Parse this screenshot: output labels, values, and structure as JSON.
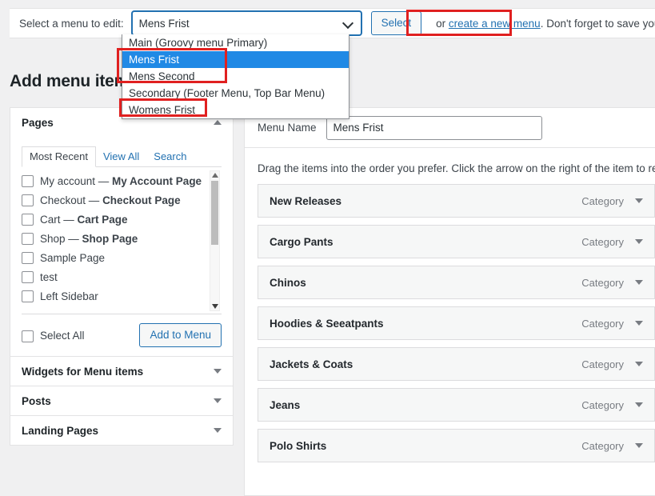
{
  "topbar": {
    "label": "Select a menu to edit:",
    "selected_menu": "Mens Frist",
    "select_button": "Select",
    "or_text": "or ",
    "create_link": "create a new menu",
    "tail_text": ". Don't forget to save your chang"
  },
  "dropdown": {
    "options": [
      {
        "label": "Main (Groovy menu Primary)",
        "selected": false
      },
      {
        "label": "Mens Frist",
        "selected": true
      },
      {
        "label": "Mens Second",
        "selected": false
      },
      {
        "label": "Secondary (Footer Menu, Top Bar Menu)",
        "selected": false
      },
      {
        "label": "Womens Frist",
        "selected": false
      }
    ]
  },
  "heading": "Add menu items",
  "sidebar": {
    "pages_panel": {
      "title": "Pages",
      "tabs": [
        {
          "label": "Most Recent",
          "active": true
        },
        {
          "label": "View All",
          "active": false
        },
        {
          "label": "Search",
          "active": false
        }
      ],
      "items": [
        {
          "name": "My account",
          "dash": " — ",
          "bold": "My Account Page"
        },
        {
          "name": "Checkout",
          "dash": " — ",
          "bold": "Checkout Page"
        },
        {
          "name": "Cart",
          "dash": " — ",
          "bold": "Cart Page"
        },
        {
          "name": "Shop",
          "dash": " — ",
          "bold": "Shop Page"
        },
        {
          "name": "Sample Page",
          "dash": "",
          "bold": ""
        },
        {
          "name": "test",
          "dash": "",
          "bold": ""
        },
        {
          "name": "Left Sidebar",
          "dash": "",
          "bold": ""
        }
      ],
      "select_all_label": "Select All",
      "add_to_menu_button": "Add to Menu"
    },
    "collapsed_panels": [
      {
        "title": "Widgets for Menu items"
      },
      {
        "title": "Posts"
      },
      {
        "title": "Landing Pages"
      }
    ]
  },
  "main": {
    "menu_name_label": "Menu Name",
    "menu_name_value": "Mens Frist",
    "drag_note": "Drag the items into the order you prefer. Click the arrow on the right of the item to rev",
    "menu_items": [
      {
        "title": "New Releases",
        "type": "Category"
      },
      {
        "title": "Cargo Pants",
        "type": "Category"
      },
      {
        "title": "Chinos",
        "type": "Category"
      },
      {
        "title": "Hoodies & Seeatpants",
        "type": "Category"
      },
      {
        "title": "Jackets & Coats",
        "type": "Category"
      },
      {
        "title": "Jeans",
        "type": "Category"
      },
      {
        "title": "Polo Shirts",
        "type": "Category"
      }
    ]
  },
  "colors": {
    "annotation_red": "#e02020",
    "selection_blue": "#2089e5",
    "link_blue": "#2271b1"
  }
}
